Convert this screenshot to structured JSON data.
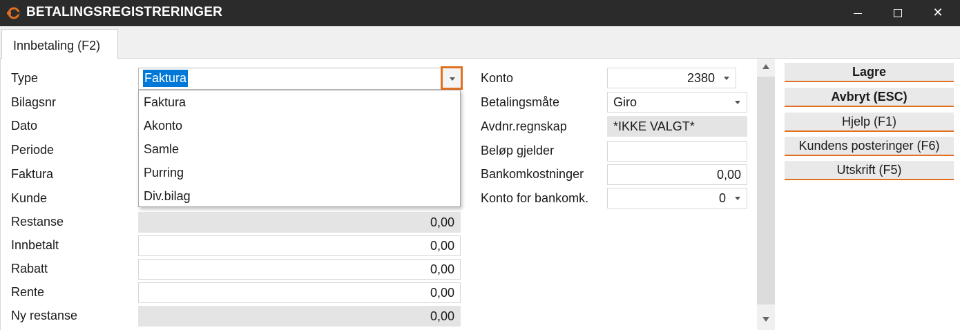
{
  "window": {
    "title": "BETALINGSREGISTRERINGER",
    "app_icon": "orange-logo-icon",
    "minimize": "minimize-icon",
    "maximize": "maximize-icon",
    "close": "close-icon",
    "close_glyph": "✕"
  },
  "tabs": [
    {
      "label": "Innbetaling (F2)"
    }
  ],
  "left_form": {
    "type": {
      "label": "Type",
      "value": "Faktura"
    },
    "bilagsnr": {
      "label": "Bilagsnr"
    },
    "dato": {
      "label": "Dato"
    },
    "periode": {
      "label": "Periode"
    },
    "faktura": {
      "label": "Faktura"
    },
    "kunde": {
      "label": "Kunde"
    },
    "restanse": {
      "label": "Restanse",
      "value": "0,00"
    },
    "innbetalt": {
      "label": "Innbetalt",
      "value": "0,00"
    },
    "rabatt": {
      "label": "Rabatt",
      "value": "0,00"
    },
    "rente": {
      "label": "Rente",
      "value": "0,00"
    },
    "ny_restanse": {
      "label": "Ny restanse",
      "value": "0,00"
    }
  },
  "type_dropdown": {
    "options": [
      "Faktura",
      "Akonto",
      "Samle",
      "Purring",
      "Div.bilag"
    ]
  },
  "right_form": {
    "konto": {
      "label": "Konto",
      "value": "2380"
    },
    "betalingsmate": {
      "label": "Betalingsmåte",
      "value": "Giro"
    },
    "avdnr": {
      "label": "Avdnr.regnskap",
      "value": "*IKKE VALGT*"
    },
    "belop_gjelder": {
      "label": "Beløp gjelder",
      "value": ""
    },
    "bankomkostninger": {
      "label": "Bankomkostninger",
      "value": "0,00"
    },
    "konto_bankomk": {
      "label": "Konto for bankomk.",
      "value": "0"
    }
  },
  "actions": {
    "lagre": "Lagre",
    "avbryt": "Avbryt (ESC)",
    "hjelp": "Hjelp (F1)",
    "kundens_posteringer": "Kundens posteringer (F6)",
    "utskrift": "Utskrift (F5)"
  },
  "colors": {
    "accent": "#e07020",
    "titlebar": "#2b2b2b",
    "selection": "#0078d7"
  }
}
